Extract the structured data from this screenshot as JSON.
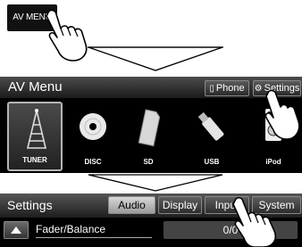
{
  "step1": {
    "key_label": "AV MENU"
  },
  "av_menu": {
    "title": "AV Menu",
    "phone_label": "Phone",
    "settings_label": "Settings",
    "sources": [
      {
        "label": "TUNER",
        "icon": "tuner-tower-icon",
        "selected": true
      },
      {
        "label": "DISC",
        "icon": "disc-icon",
        "selected": false
      },
      {
        "label": "SD",
        "icon": "sd-card-icon",
        "selected": false
      },
      {
        "label": "USB",
        "icon": "usb-icon",
        "selected": false
      },
      {
        "label": "iPod",
        "icon": "ipod-icon",
        "selected": false
      }
    ]
  },
  "settings": {
    "title": "Settings",
    "tabs": [
      "Audio",
      "Display",
      "Input",
      "System"
    ],
    "active_tab": "Audio",
    "row": {
      "label": "Fader/Balance",
      "value": "0/0"
    }
  }
}
